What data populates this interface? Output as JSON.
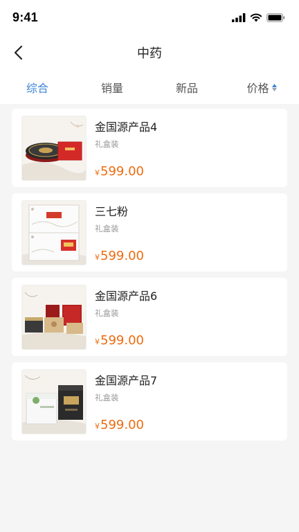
{
  "status": {
    "time": "9:41",
    "icons": [
      "signal-icon",
      "wifi-icon",
      "battery-icon"
    ]
  },
  "nav": {
    "title": "中药",
    "back_icon": "chevron-left-icon"
  },
  "tabs": [
    {
      "label": "综合",
      "active": true
    },
    {
      "label": "销量",
      "active": false
    },
    {
      "label": "新品",
      "active": false
    },
    {
      "label": "价格",
      "active": false,
      "sort_icon": "sort-arrows-icon"
    }
  ],
  "products": [
    {
      "name": "金国源产品4",
      "subtitle": "礼盒装",
      "currency": "¥",
      "price": "599.00"
    },
    {
      "name": "三七粉",
      "subtitle": "礼盒装",
      "currency": "¥",
      "price": "599.00"
    },
    {
      "name": "金国源产品6",
      "subtitle": "礼盒装",
      "currency": "¥",
      "price": "599.00"
    },
    {
      "name": "金国源产品7",
      "subtitle": "礼盒装",
      "currency": "¥",
      "price": "599.00"
    }
  ],
  "colors": {
    "accent": "#3a84d8",
    "price": "#ee6b0f",
    "background": "#f5f5f5"
  }
}
